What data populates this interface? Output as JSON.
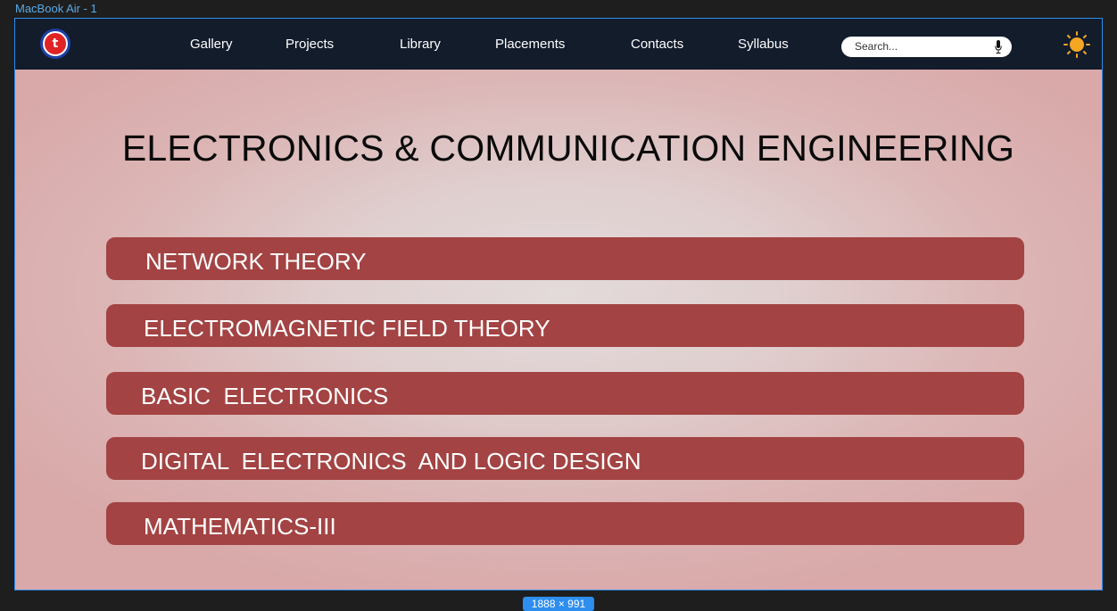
{
  "frame": {
    "label": "MacBook Air - 1",
    "dimensions": "1888 × 991"
  },
  "navbar": {
    "logo_letter": "t",
    "links": [
      "Gallery",
      "Projects",
      "Library",
      "Placements",
      "Contacts",
      "Syllabus"
    ],
    "search_placeholder": "Search...",
    "icons": [
      "logo-icon",
      "mic-icon",
      "sun-icon"
    ]
  },
  "main": {
    "title": "ELECTRONICS & COMMUNICATION ENGINEERING",
    "subjects": [
      "NETWORK THEORY",
      "ELECTROMAGNETIC FIELD THEORY",
      "BASIC  ELECTRONICS",
      "DIGITAL  ELECTRONICS  AND LOGIC DESIGN",
      "MATHEMATICS-III"
    ]
  },
  "colors": {
    "navbar_bg": "#131c2b",
    "subject_bar": "#a34343",
    "page_bg": "#e0cfcf",
    "selection_blue": "#2d8ef0",
    "sun": "#f5a623"
  }
}
